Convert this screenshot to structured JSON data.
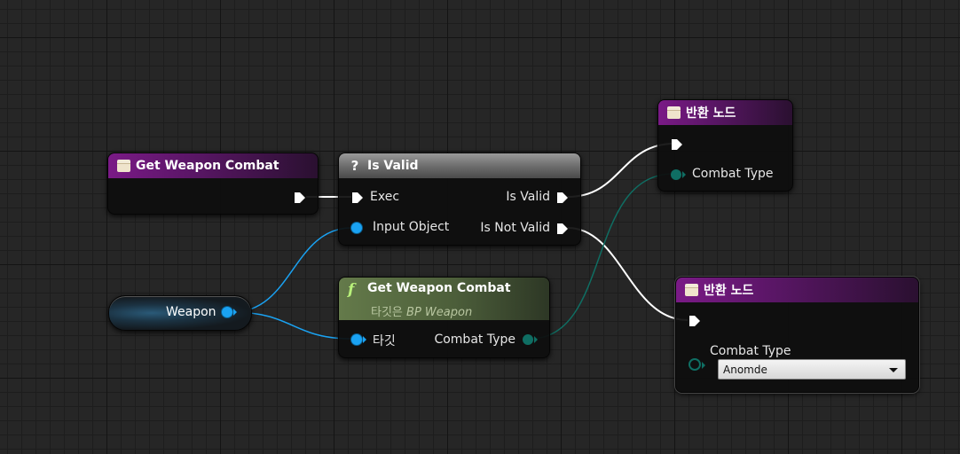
{
  "colors": {
    "exec": "#ffffff",
    "object_pin": "#1aa2f2",
    "enum_pin": "#0f6e63",
    "function_header": "#5a1666",
    "pure_function_header": "#4c5e3a",
    "macro_header": "#6e6e6e"
  },
  "nodes": {
    "entry": {
      "title": "Get Weapon Combat",
      "icon": "function-entry-icon"
    },
    "is_valid": {
      "title": "Is Valid",
      "icon": "question-icon",
      "exec_in": "Exec",
      "input": "Input Object",
      "out_valid": "Is Valid",
      "out_not_valid": "Is Not Valid"
    },
    "return_top": {
      "title": "반환 노드",
      "icon": "return-node-icon",
      "pin": "Combat Type"
    },
    "weapon_var": {
      "label": "Weapon"
    },
    "get_combat": {
      "title": "Get Weapon Combat",
      "icon": "function-f-icon",
      "subtitle_prefix": "타깃은",
      "subtitle_target": "BP Weapon",
      "in_target": "타깃",
      "out": "Combat Type"
    },
    "return_bottom": {
      "title": "반환 노드",
      "icon": "return-node-icon",
      "pin": "Combat Type",
      "selected_value": "Anomde"
    }
  }
}
